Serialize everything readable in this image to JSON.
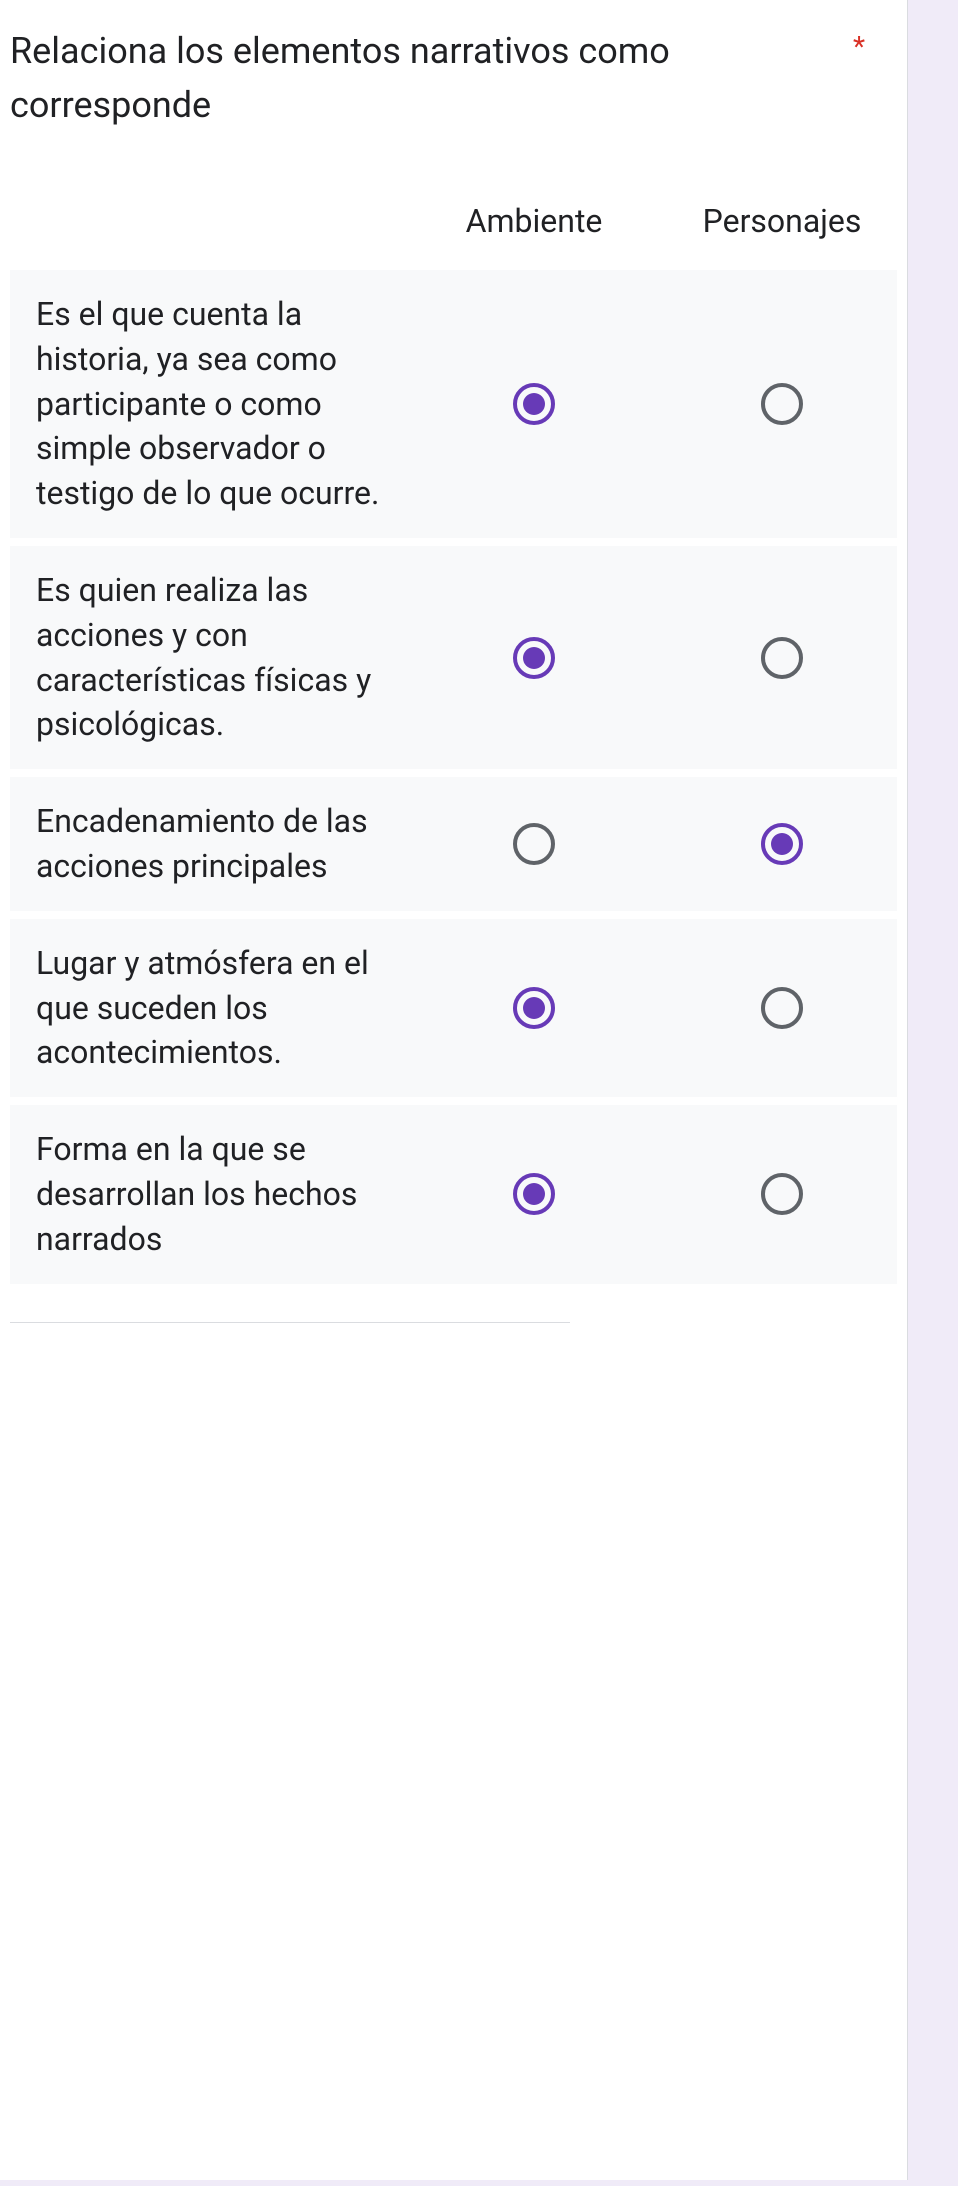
{
  "question": {
    "title": "Relaciona los elementos narrativos como corresponde",
    "required_mark": "*"
  },
  "columns": [
    {
      "label": "Ambiente"
    },
    {
      "label": "Personajes"
    }
  ],
  "rows": [
    {
      "label": "Es el que cuenta la historia, ya sea como participante o como simple observador o testigo de lo que ocurre.",
      "selected": 0
    },
    {
      "label": "Es quien realiza las acciones y con características físicas y psicológicas.",
      "selected": 0
    },
    {
      "label": "Encadenamiento de las acciones principales",
      "selected": 1
    },
    {
      "label": "Lugar y atmósfera en el que suceden los acontecimientos.",
      "selected": 0
    },
    {
      "label": "Forma en la que se desarrollan los hechos narrados",
      "selected": 0
    }
  ]
}
